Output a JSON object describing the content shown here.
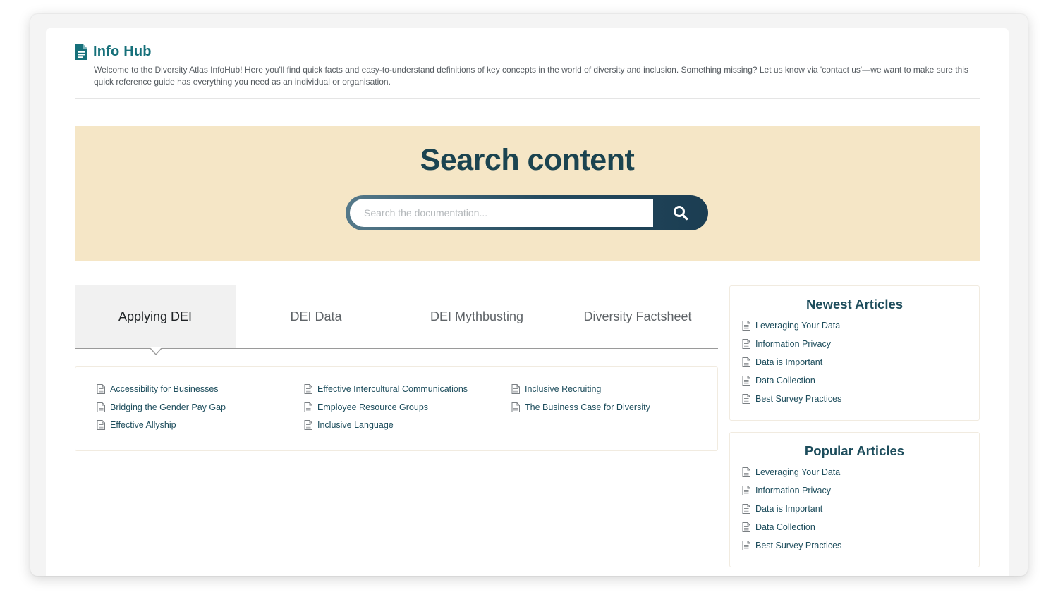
{
  "header": {
    "title": "Info Hub",
    "description": "Welcome to the Diversity Atlas InfoHub! Here you'll find quick facts and easy-to-understand definitions of key concepts in the world of diversity and inclusion. Something missing? Let us know via 'contact us'—we want to make sure this quick reference guide has everything you need as an individual or organisation."
  },
  "search": {
    "title": "Search content",
    "placeholder": "Search the documentation...",
    "button_icon": "search-icon"
  },
  "tabs": [
    {
      "label": "Applying DEI",
      "active": true
    },
    {
      "label": "DEI Data",
      "active": false
    },
    {
      "label": "DEI Mythbusting",
      "active": false
    },
    {
      "label": "Diversity Factsheet",
      "active": false
    }
  ],
  "articles": {
    "columns": [
      [
        "Accessibility for Businesses",
        "Bridging the Gender Pay Gap",
        "Effective Allyship"
      ],
      [
        "Effective Intercultural Communications",
        "Employee Resource Groups",
        "Inclusive Language"
      ],
      [
        "Inclusive Recruiting",
        "The Business Case for Diversity"
      ]
    ]
  },
  "newest": {
    "title": "Newest Articles",
    "items": [
      "Leveraging Your Data",
      "Information Privacy",
      "Data is Important",
      "Data Collection",
      "Best Survey Practices"
    ]
  },
  "popular": {
    "title": "Popular Articles",
    "items": [
      "Leveraging Your Data",
      "Information Privacy",
      "Data is Important",
      "Data Collection",
      "Best Survey Practices"
    ]
  },
  "colors": {
    "brand_teal": "#16707a",
    "dark_navy": "#1b4450",
    "search_band": "#f5e6c6",
    "link": "#1d4d5c"
  }
}
